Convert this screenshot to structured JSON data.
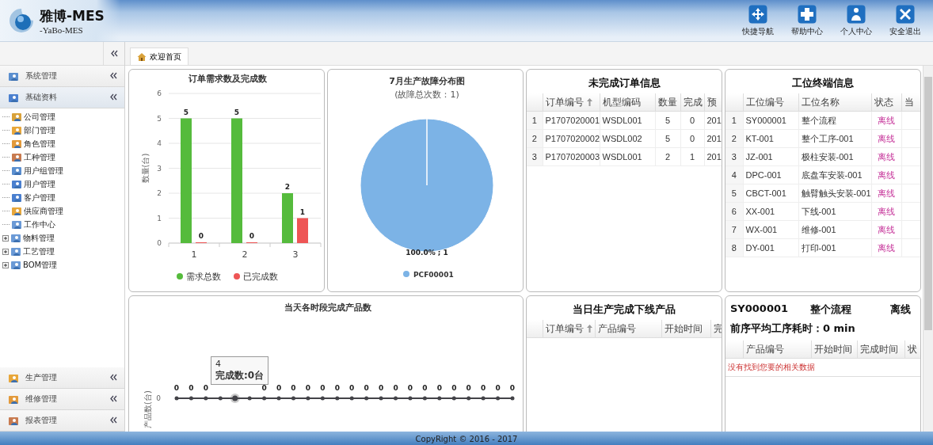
{
  "header": {
    "title": "雅博-MES",
    "subtitle": "-YaBo-MES",
    "nav": [
      {
        "label": "快捷导航",
        "kind": "move"
      },
      {
        "label": "帮助中心",
        "kind": "plus"
      },
      {
        "label": "个人中心",
        "kind": "user"
      },
      {
        "label": "安全退出",
        "kind": "close"
      }
    ]
  },
  "sidebar": {
    "sections": [
      {
        "label": "系统管理",
        "expanded": false
      },
      {
        "label": "基础资料",
        "expanded": true,
        "items": [
          {
            "label": "公司管理"
          },
          {
            "label": "部门管理"
          },
          {
            "label": "角色管理"
          },
          {
            "label": "工种管理"
          },
          {
            "label": "用户组管理"
          },
          {
            "label": "用户管理"
          },
          {
            "label": "客户管理"
          },
          {
            "label": "供应商管理"
          },
          {
            "label": "工作中心"
          },
          {
            "label": "物料管理",
            "expanded": false
          },
          {
            "label": "工艺管理",
            "expanded": false
          },
          {
            "label": "BOM管理",
            "expanded": false
          }
        ]
      }
    ],
    "bottom_sections": [
      {
        "label": "生产管理"
      },
      {
        "label": "维修管理"
      },
      {
        "label": "报表管理"
      }
    ]
  },
  "tabs": [
    {
      "label": "欢迎首页",
      "selected": true
    }
  ],
  "order_chart": {
    "chart_data": {
      "type": "bar",
      "title": "订单需求数及完成数",
      "ylabel": "数量(台)",
      "categories": [
        "1",
        "2",
        "3"
      ],
      "series": [
        {
          "name": "需求总数",
          "color": "#55bb3c",
          "values": [
            5,
            5,
            2
          ]
        },
        {
          "name": "已完成数",
          "color": "#ee5555",
          "values": [
            0,
            0,
            1
          ]
        }
      ],
      "ylim": [
        0,
        6
      ],
      "yticks": [
        0,
        1,
        2,
        3,
        4,
        5,
        6
      ],
      "data_labels": true,
      "grid": true,
      "legend": true
    }
  },
  "fault_chart": {
    "title": "7月生产故障分布图",
    "subtitle": "(故障总次数：1)",
    "slice_label": "100.0% ; 1",
    "legend": [
      "PCF00001"
    ]
  },
  "open_orders": {
    "title": "未完成订单信息",
    "columns": [
      {
        "label": "订单编号",
        "sorted": true
      },
      {
        "label": "机型编码"
      },
      {
        "label": "数量"
      },
      {
        "label": "完成"
      },
      {
        "label": "预"
      }
    ],
    "rows": [
      {
        "index": "1",
        "cells": [
          "P1707020001",
          "WSDL001",
          "5",
          "0",
          "201"
        ]
      },
      {
        "index": "2",
        "cells": [
          "P1707020002",
          "WSDL002",
          "5",
          "0",
          "201"
        ]
      },
      {
        "index": "3",
        "cells": [
          "P1707020003",
          "WSDL001",
          "2",
          "1",
          "201"
        ]
      }
    ]
  },
  "stations": {
    "title": "工位终端信息",
    "columns": [
      "工位编号",
      "工位名称",
      "状态",
      "当"
    ],
    "rows": [
      {
        "index": "1",
        "code": "SY000001",
        "name": "整个流程",
        "status": "离线"
      },
      {
        "index": "2",
        "code": "KT-001",
        "name": "整个工序-001",
        "status": "离线"
      },
      {
        "index": "3",
        "code": "JZ-001",
        "name": "极柱安装-001",
        "status": "离线"
      },
      {
        "index": "4",
        "code": "DPC-001",
        "name": "底盘车安装-001",
        "status": "离线"
      },
      {
        "index": "5",
        "code": "CBCT-001",
        "name": "触臂触头安装-001",
        "status": "离线"
      },
      {
        "index": "6",
        "code": "XX-001",
        "name": "下线-001",
        "status": "离线"
      },
      {
        "index": "7",
        "code": "WX-001",
        "name": "维修-001",
        "status": "离线"
      },
      {
        "index": "8",
        "code": "DY-001",
        "name": "打印-001",
        "status": "离线"
      }
    ]
  },
  "hourly_chart": {
    "title": "当天各时段完成产品数",
    "ylabel": "产品数(台)",
    "y_tick": "0",
    "labels_left_of_tooltip": [
      "0",
      "0",
      "0"
    ],
    "labels_right_of_tooltip": [
      "0",
      "0",
      "0",
      "0",
      "0",
      "0",
      "0",
      "0",
      "0",
      "0",
      "0",
      "0",
      "0",
      "0",
      "0",
      "0",
      "0",
      "0"
    ],
    "tooltip": {
      "title": "4",
      "text": "完成数:0台"
    }
  },
  "finished_products": {
    "title": "当日生产完成下线产品",
    "columns": [
      {
        "label": "订单编号",
        "sorted": true
      },
      {
        "label": "产品编号"
      },
      {
        "label": "开始时间"
      },
      {
        "label": "完"
      }
    ]
  },
  "station_detail": {
    "code": "SY000001",
    "name": "整个流程",
    "status": "离线",
    "avg_time": "前序平均工序耗时：0 min",
    "columns": [
      "产品编号",
      "开始时间",
      "完成时间",
      "状"
    ],
    "empty_message": "没有找到您要的相关数据"
  },
  "footer": "CopyRight © 2016 - 2017"
}
